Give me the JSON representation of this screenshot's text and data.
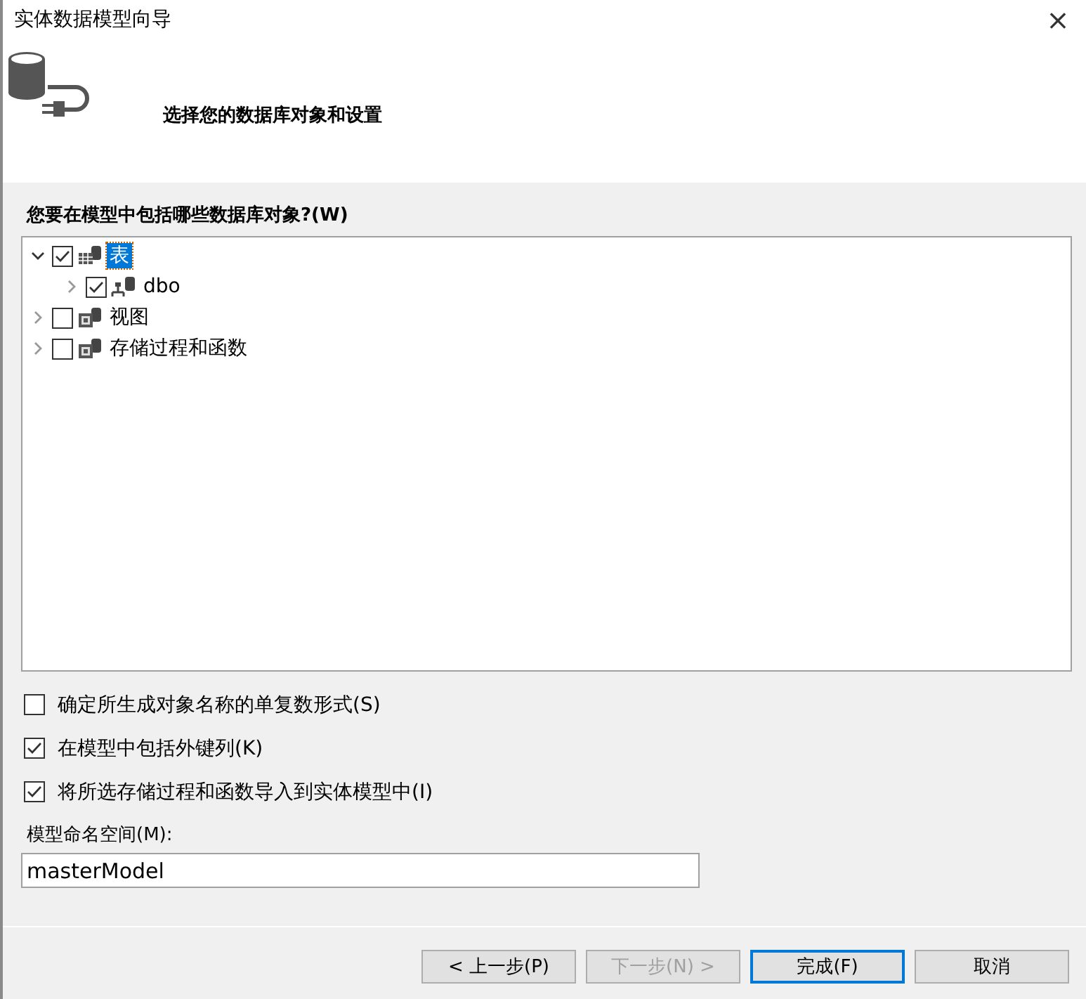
{
  "window": {
    "title": "实体数据模型向导",
    "close": "×"
  },
  "header": {
    "subtitle": "选择您的数据库对象和设置"
  },
  "objects": {
    "label": "您要在模型中包括哪些数据库对象?(W)",
    "tree": [
      {
        "label": "表",
        "kind": "tables",
        "checked": true,
        "expanded": true,
        "selected": true,
        "children": [
          {
            "label": "dbo",
            "kind": "schema",
            "checked": true,
            "expanded": false,
            "selected": false
          }
        ]
      },
      {
        "label": "视图",
        "kind": "views",
        "checked": false,
        "expanded": false,
        "selected": false
      },
      {
        "label": "存储过程和函数",
        "kind": "procs",
        "checked": false,
        "expanded": false,
        "selected": false
      }
    ]
  },
  "options": [
    {
      "label": "确定所生成对象名称的单复数形式(S)",
      "checked": false
    },
    {
      "label": "在模型中包括外键列(K)",
      "checked": true
    },
    {
      "label": "将所选存储过程和函数导入到实体模型中(I)",
      "checked": true
    }
  ],
  "namespace": {
    "label": "模型命名空间(M):",
    "value": "masterModel"
  },
  "buttons": [
    {
      "label": "< 上一步(P)",
      "disabled": false,
      "default": false
    },
    {
      "label": "下一步(N) >",
      "disabled": true,
      "default": false
    },
    {
      "label": "完成(F)",
      "disabled": false,
      "default": true
    },
    {
      "label": "取消",
      "disabled": false,
      "default": false
    }
  ]
}
